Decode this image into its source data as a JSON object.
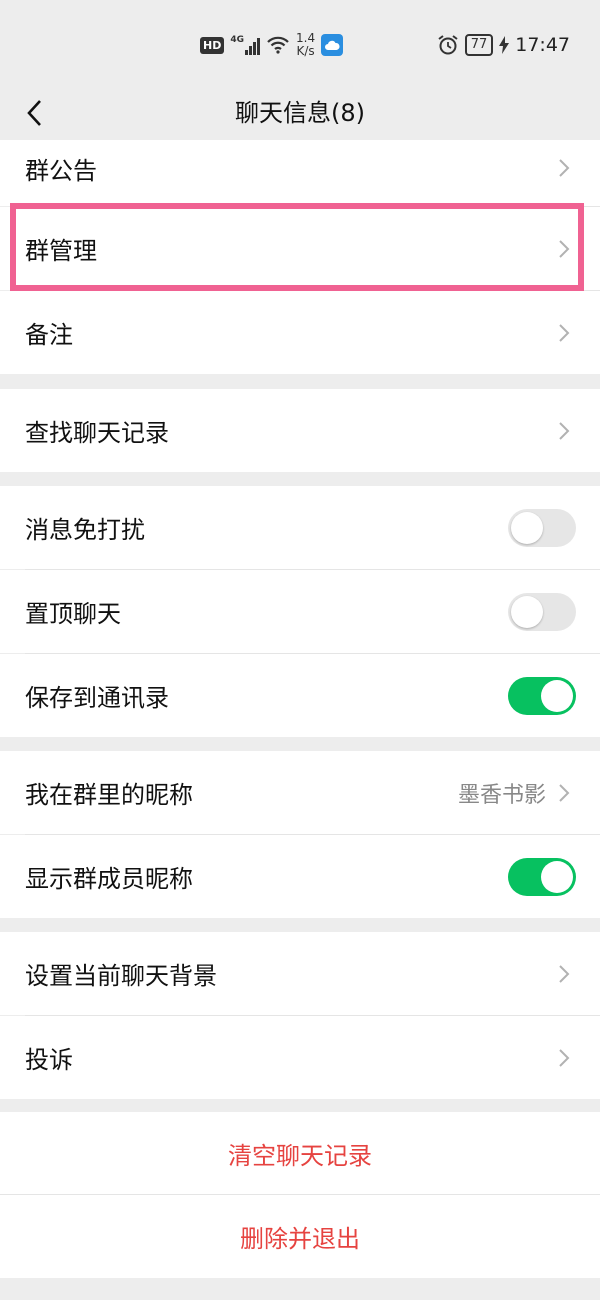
{
  "status_bar": {
    "hd": "HD",
    "network": "4G",
    "speed_value": "1.4",
    "speed_unit": "K/s",
    "battery": "77",
    "time": "17:47"
  },
  "nav": {
    "title": "聊天信息(8)"
  },
  "sections": {
    "group_notice": "群公告",
    "group_manage": "群管理",
    "remark": "备注",
    "search_history": "查找聊天记录",
    "mute": "消息免打扰",
    "pin": "置顶聊天",
    "save_contacts": "保存到通讯录",
    "my_nickname": "我在群里的昵称",
    "my_nickname_value": "墨香书影",
    "show_nicknames": "显示群成员昵称",
    "chat_background": "设置当前聊天背景",
    "complain": "投诉"
  },
  "toggles": {
    "mute": false,
    "pin": false,
    "save_contacts": true,
    "show_nicknames": true
  },
  "actions": {
    "clear_history": "清空聊天记录",
    "delete_exit": "删除并退出"
  },
  "colors": {
    "accent_green": "#07c160",
    "danger_red": "#e64340",
    "highlight_pink": "#f06292"
  }
}
